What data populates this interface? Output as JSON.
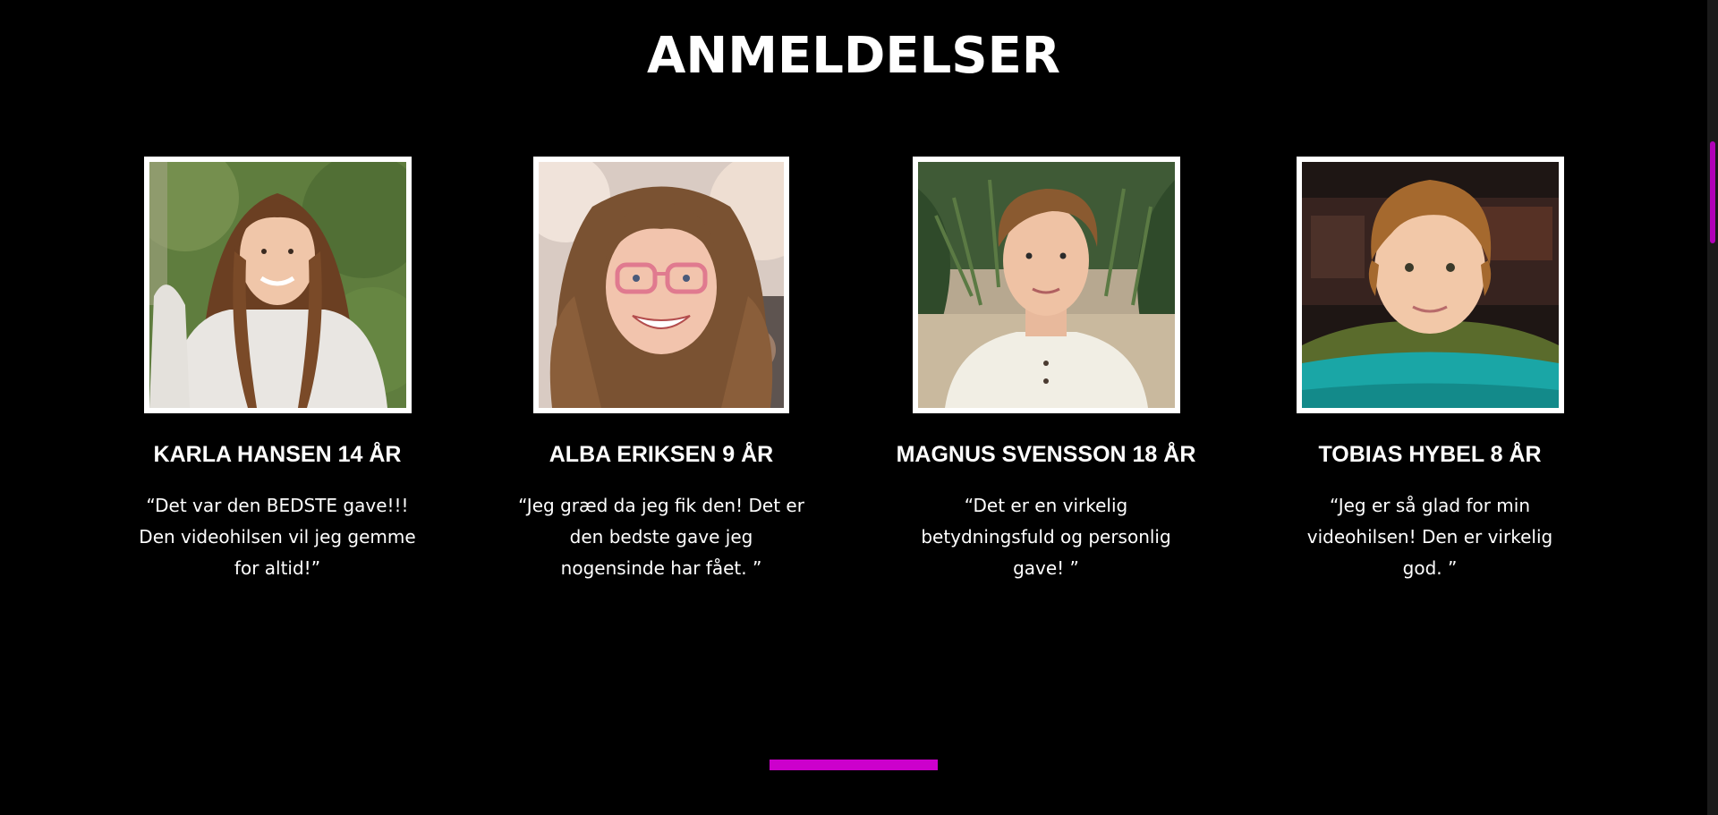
{
  "section": {
    "title": "ANMELDELSER"
  },
  "reviews": [
    {
      "name": "KARLA HANSEN 14 ÅR",
      "quote": "“Det var den BEDSTE gave!!! Den videohilsen vil jeg gemme for altid!”"
    },
    {
      "name": "ALBA ERIKSEN 9 ÅR",
      "quote": "“Jeg græd da jeg fik den! Det er den bedste gave jeg nogensinde har fået. ”"
    },
    {
      "name": "MAGNUS SVENSSON 18 ÅR",
      "quote": "“Det er en virkelig betydningsfuld og personlig gave! ”"
    },
    {
      "name": "TOBIAS HYBEL 8 ÅR",
      "quote": "“Jeg er så glad for min videohilsen! Den er virkelig god. ”"
    }
  ],
  "colors": {
    "background": "#000000",
    "text": "#ffffff",
    "accent": "#cc00cc"
  }
}
